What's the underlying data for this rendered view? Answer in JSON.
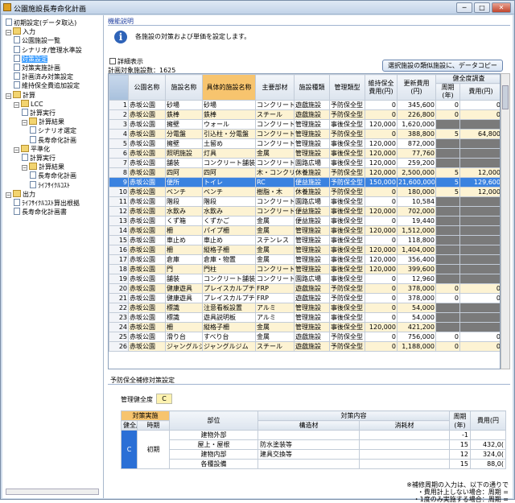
{
  "window": {
    "title": "公園施設長寿命化計画",
    "controls": [
      "─",
      "□",
      "✕"
    ]
  },
  "tree": [
    {
      "label": "初期設定(データ取込)",
      "level": 0,
      "kind": "doc",
      "exp": ""
    },
    {
      "label": "入力",
      "level": 0,
      "kind": "folder",
      "exp": "−"
    },
    {
      "label": "公園施設一覧",
      "level": 1,
      "kind": "doc",
      "exp": ""
    },
    {
      "label": "シナリオ/管理水準設",
      "level": 1,
      "kind": "doc",
      "exp": ""
    },
    {
      "label": "対策設定",
      "level": 1,
      "kind": "doc",
      "exp": "",
      "selected": true
    },
    {
      "label": "対策実施計画",
      "level": 1,
      "kind": "doc",
      "exp": ""
    },
    {
      "label": "計画済み対策設定",
      "level": 1,
      "kind": "doc",
      "exp": ""
    },
    {
      "label": "維持保全費追加設定",
      "level": 1,
      "kind": "doc",
      "exp": ""
    },
    {
      "label": "計算",
      "level": 0,
      "kind": "folder",
      "exp": "−"
    },
    {
      "label": "LCC",
      "level": 1,
      "kind": "folder",
      "exp": "−"
    },
    {
      "label": "計算実行",
      "level": 2,
      "kind": "doc",
      "exp": ""
    },
    {
      "label": "計算結果",
      "level": 2,
      "kind": "folder",
      "exp": "−"
    },
    {
      "label": "シナリオ選定",
      "level": 3,
      "kind": "doc",
      "exp": ""
    },
    {
      "label": "長寿命化計画",
      "level": 3,
      "kind": "doc",
      "exp": ""
    },
    {
      "label": "平準化",
      "level": 1,
      "kind": "folder",
      "exp": "−"
    },
    {
      "label": "計算実行",
      "level": 2,
      "kind": "doc",
      "exp": ""
    },
    {
      "label": "計算結果",
      "level": 2,
      "kind": "folder",
      "exp": "−"
    },
    {
      "label": "長寿命化計画",
      "level": 3,
      "kind": "doc",
      "exp": ""
    },
    {
      "label": "ﾗｲﾌｻｲｸﾙｺｽﾄ",
      "level": 3,
      "kind": "doc",
      "exp": ""
    },
    {
      "label": "出力",
      "level": 0,
      "kind": "folder",
      "exp": "−"
    },
    {
      "label": "ﾗｲﾌｻｲｸﾙｺｽﾄ算出根拠",
      "level": 1,
      "kind": "doc",
      "exp": ""
    },
    {
      "label": "長寿命化計画書",
      "level": 1,
      "kind": "doc",
      "exp": ""
    }
  ],
  "main": {
    "section_title": "機能説明",
    "description": "各施設の対策および単価を設定します。",
    "detail_checkbox": "詳細表示",
    "count_label": "計画対象施設数：1625",
    "copy_button": "選択施設の類似施設に、データコピー"
  },
  "grid": {
    "headers": {
      "park": "公園名称",
      "facility": "施設名称",
      "specific": "具体的施設名称",
      "material": "主要部材",
      "type": "施設種類",
      "mgmt": "管理類型",
      "maint_cost": "維持保全費用(円)",
      "renewal_cost": "更新費用(円)",
      "health_group": "健全度調査",
      "cycle": "周期(年)",
      "cost": "費用(円)"
    },
    "rows": [
      [
        "1",
        "赤坂公園",
        "砂場",
        "砂場",
        "コンクリート",
        "遊戯施設",
        "予防保全型",
        "0",
        "345,600",
        "0",
        "0"
      ],
      [
        "2",
        "赤坂公園",
        "鉄棒",
        "鉄棒",
        "スチール",
        "遊戯施設",
        "予防保全型",
        "0",
        "226,800",
        "0",
        "0"
      ],
      [
        "3",
        "赤坂公園",
        "擁壁",
        "ウォール",
        "コンクリート",
        "管理施設",
        "事後保全型",
        "120,000",
        "1,620,000",
        "",
        ""
      ],
      [
        "4",
        "赤坂公園",
        "分電盤",
        "引込柱・分電盤",
        "コンクリート",
        "管理施設",
        "予防保全型",
        "0",
        "388,800",
        "5",
        "64,800"
      ],
      [
        "5",
        "赤坂公園",
        "擁壁",
        "土留め",
        "コンクリート",
        "管理施設",
        "事後保全型",
        "120,000",
        "872,000",
        "",
        ""
      ],
      [
        "6",
        "赤坂公園",
        "照明施設",
        "灯具",
        "金属",
        "管理施設",
        "事後保全型",
        "120,000",
        "77,760",
        "",
        ""
      ],
      [
        "7",
        "赤坂公園",
        "舗装",
        "コンクリート舗装",
        "コンクリート",
        "園路広場",
        "事後保全型",
        "120,000",
        "259,200",
        "",
        ""
      ],
      [
        "8",
        "赤坂公園",
        "四阿",
        "四阿",
        "木・コンクリ",
        "休養施設",
        "予防保全型",
        "120,000",
        "2,500,000",
        "5",
        "12,000"
      ],
      [
        "9",
        "赤坂公園",
        "便所",
        "トイレ",
        "RC",
        "便益施設",
        "予防保全型",
        "150,000",
        "21,600,000",
        "5",
        "129,600"
      ],
      [
        "10",
        "赤坂公園",
        "ベンチ",
        "ベンチ",
        "樹脂・木",
        "休養施設",
        "予防保全型",
        "0",
        "180,000",
        "5",
        "12,000"
      ],
      [
        "11",
        "赤坂公園",
        "階段",
        "階段",
        "コンクリート",
        "園路広場",
        "事後保全型",
        "0",
        "10,584",
        "",
        ""
      ],
      [
        "12",
        "赤坂公園",
        "水飲み",
        "水飲み",
        "コンクリート",
        "便益施設",
        "事後保全型",
        "120,000",
        "702,000",
        "",
        ""
      ],
      [
        "13",
        "赤坂公園",
        "くず箱",
        "くずかご",
        "金属",
        "便益施設",
        "事後保全型",
        "0",
        "19,440",
        "",
        ""
      ],
      [
        "14",
        "赤坂公園",
        "柵",
        "パイプ柵",
        "金属",
        "管理施設",
        "事後保全型",
        "120,000",
        "1,512,000",
        "",
        ""
      ],
      [
        "15",
        "赤坂公園",
        "車止め",
        "車止め",
        "ステンレス",
        "管理施設",
        "事後保全型",
        "0",
        "118,800",
        "",
        ""
      ],
      [
        "16",
        "赤坂公園",
        "柵",
        "縦格子柵",
        "金属",
        "管理施設",
        "事後保全型",
        "120,000",
        "1,404,000",
        "",
        ""
      ],
      [
        "17",
        "赤坂公園",
        "倉庫",
        "倉庫・物置",
        "金属",
        "管理施設",
        "事後保全型",
        "120,000",
        "356,400",
        "",
        ""
      ],
      [
        "18",
        "赤坂公園",
        "門",
        "門柱",
        "コンクリート",
        "管理施設",
        "事後保全型",
        "120,000",
        "399,600",
        "",
        ""
      ],
      [
        "19",
        "赤坂公園",
        "舗装",
        "コンクリート舗装",
        "コンクリート",
        "園路広場",
        "事後保全型",
        "0",
        "12,960",
        "",
        ""
      ],
      [
        "20",
        "赤坂公園",
        "健康遊具",
        "プレイスカルプチ",
        "FRP",
        "遊戯施設",
        "予防保全型",
        "0",
        "378,000",
        "0",
        "0"
      ],
      [
        "21",
        "赤坂公園",
        "健康遊具",
        "プレイスカルプチ",
        "FRP",
        "遊戯施設",
        "予防保全型",
        "0",
        "378,000",
        "0",
        "0"
      ],
      [
        "22",
        "赤坂公園",
        "標識",
        "注意看板設置",
        "アルミ",
        "管理施設",
        "事後保全型",
        "0",
        "54,000",
        "",
        ""
      ],
      [
        "23",
        "赤坂公園",
        "標識",
        "遊具説明板",
        "アルミ",
        "管理施設",
        "事後保全型",
        "0",
        "54,000",
        "",
        ""
      ],
      [
        "24",
        "赤坂公園",
        "柵",
        "縦格子柵",
        "金属",
        "管理施設",
        "事後保全型",
        "120,000",
        "421,200",
        "",
        ""
      ],
      [
        "25",
        "赤坂公園",
        "滑り台",
        "すべり台",
        "金属",
        "遊戯施設",
        "予防保全型",
        "0",
        "756,000",
        "0",
        "0"
      ],
      [
        "26",
        "赤坂公園",
        "ジャングルジム",
        "ジャングルジム",
        "スチール",
        "遊戯施設",
        "予防保全型",
        "0",
        "1,188,000",
        "0",
        "0"
      ]
    ]
  },
  "lower": {
    "section_title": "予防保全補修対策設定",
    "grade_label": "管理健全度",
    "grade_value": "C",
    "headers": {
      "target": "対策実施",
      "health": "健全度",
      "timing": "時期",
      "part": "部位",
      "content": "対策内容",
      "structure": "構造材",
      "consumable": "消耗材",
      "cycle": "周期(年)",
      "cost": "費用(円"
    },
    "health": "C",
    "timing": "初期",
    "rows": [
      {
        "part": "建物外部",
        "structure": "",
        "consumable": "",
        "cycle": "-1",
        "cost": ""
      },
      {
        "part": "屋上・屋根",
        "structure": "防水塗装等",
        "consumable": "",
        "cycle": "15",
        "cost": "432,0("
      },
      {
        "part": "建物内部",
        "structure": "建具交換等",
        "consumable": "",
        "cycle": "12",
        "cost": "324,0("
      },
      {
        "part": "各種設備",
        "structure": "",
        "consumable": "",
        "cycle": "15",
        "cost": "88,0("
      }
    ],
    "notes": [
      "※補修周期の入力は、以下の通りで",
      "・費用計上しない場合：周期 =",
      "・1度のみ実施する場合：周期 ="
    ]
  }
}
